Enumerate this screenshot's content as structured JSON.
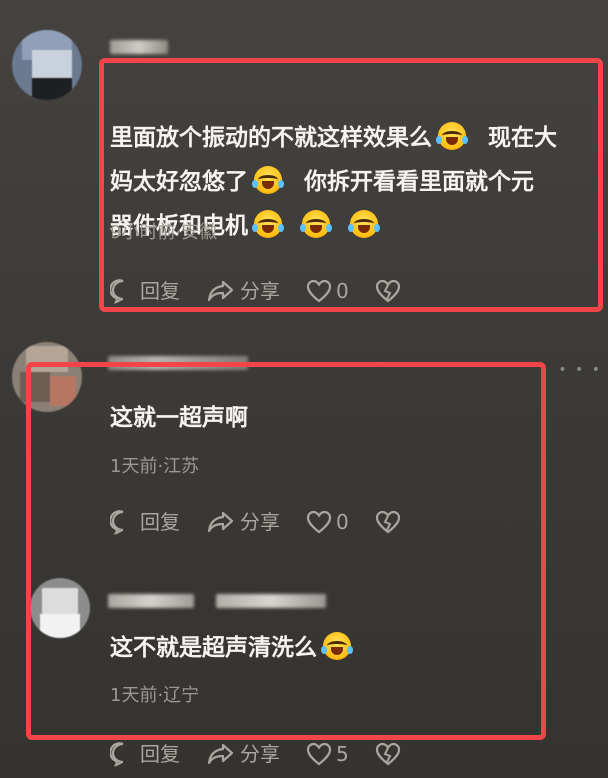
{
  "comments": [
    {
      "text_parts": [
        "里面放个振动的不就这样效果么",
        "  现在大",
        "\n妈太好忽悠了",
        "  你拆开看看里面就个元",
        "\n器件板和电机",
        " ",
        " ",
        ""
      ],
      "meta": "9小时前·安徽",
      "reply_label": "回复",
      "share_label": "分享",
      "like_count": "0"
    },
    {
      "text": "这就一超声啊",
      "meta": "1天前·江苏",
      "reply_label": "回复",
      "share_label": "分享",
      "like_count": "0"
    },
    {
      "text": "这不就是超声清洗么",
      "meta": "1天前·辽宁",
      "reply_label": "回复",
      "share_label": "分享",
      "like_count": "5"
    }
  ],
  "colors": {
    "highlight_border": "#f2454a",
    "meta_text": "#9c9892",
    "action_text": "#aaa6a0"
  },
  "icons": [
    "reply-icon",
    "share-icon",
    "heart-icon",
    "broken-heart-icon",
    "cry-laugh-emoji"
  ]
}
